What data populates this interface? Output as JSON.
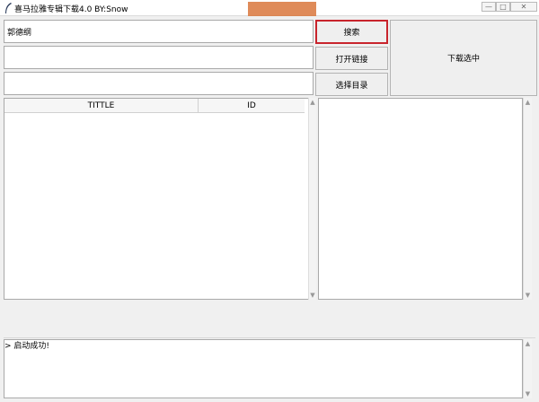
{
  "window": {
    "title": "喜马拉雅专辑下载4.0 BY:Snow",
    "controls": {
      "minimize": "—",
      "maximize": "□",
      "close": "✕"
    }
  },
  "inputs": {
    "query_value": "郭德纲",
    "link_value": "",
    "dir_value": ""
  },
  "buttons": {
    "search": "搜索",
    "open_link": "打开链接",
    "choose_dir": "选择目录",
    "download_selected": "下载选中"
  },
  "table": {
    "columns": [
      "TITTLE",
      "ID"
    ],
    "rows": []
  },
  "log": {
    "prompt": ">",
    "message": "启动成功!"
  },
  "colors": {
    "highlight": "#c8242c",
    "title_accent": "#d9773c"
  }
}
